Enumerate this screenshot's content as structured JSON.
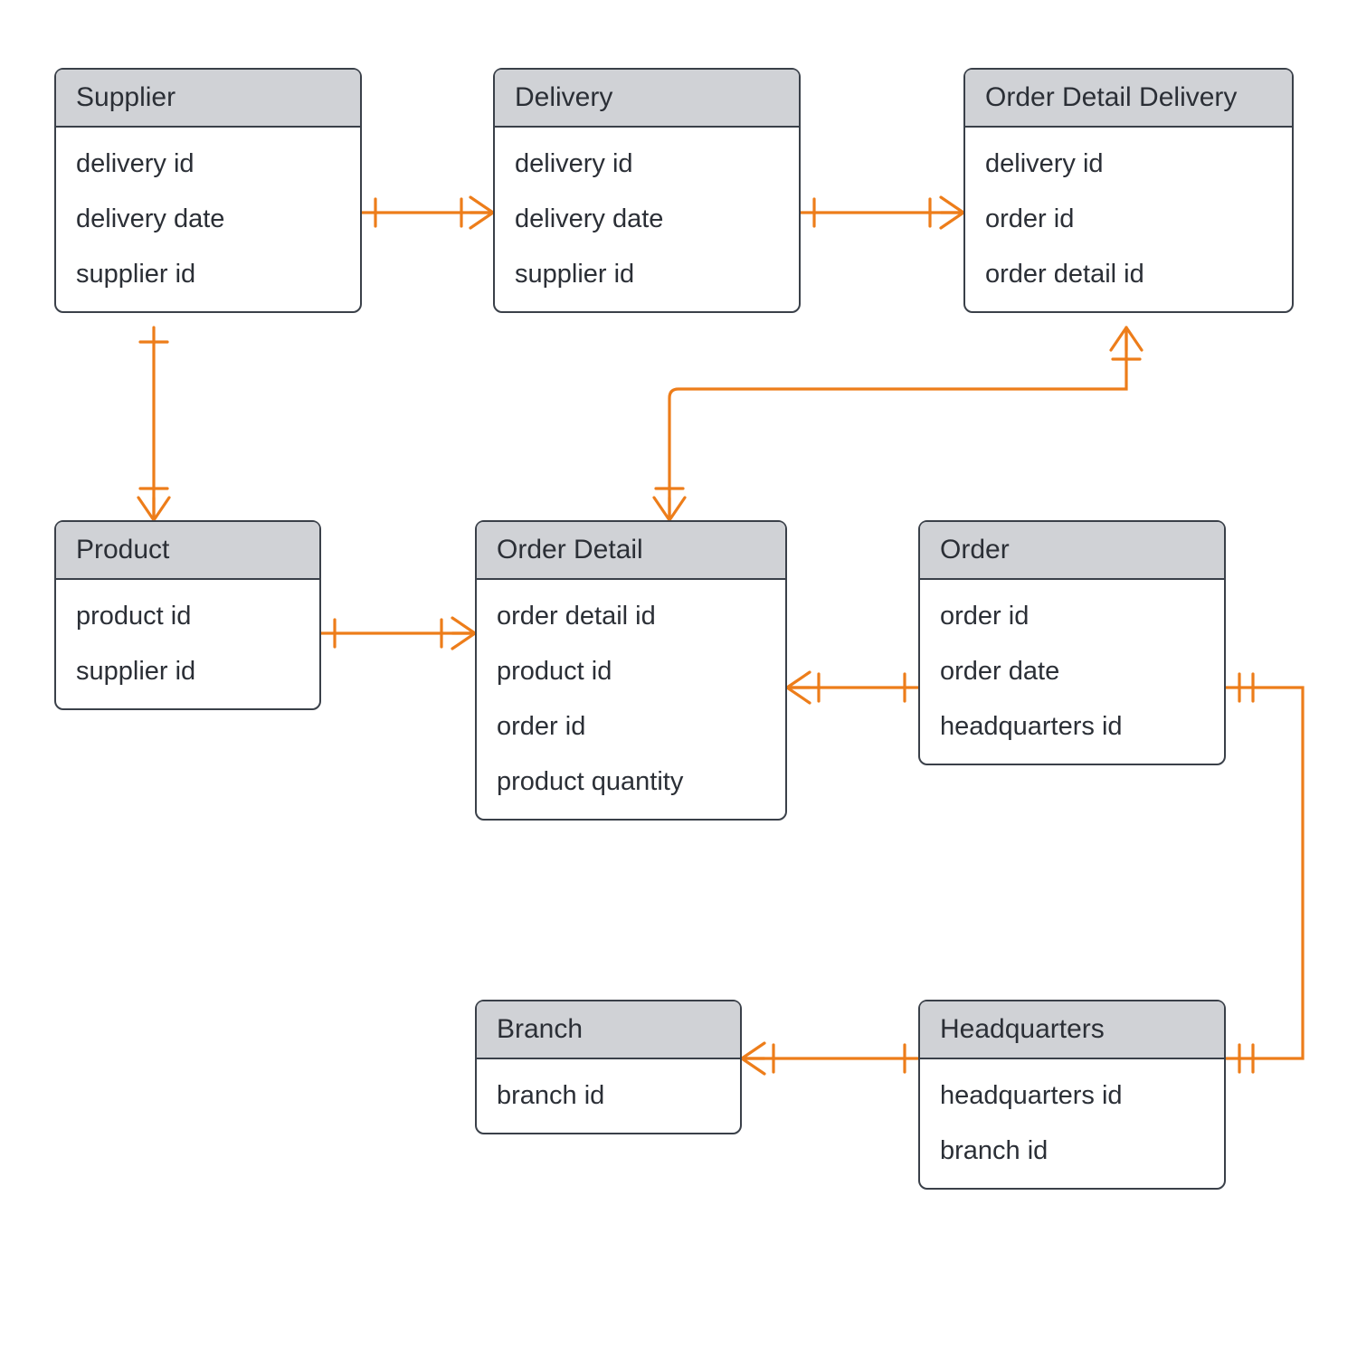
{
  "colors": {
    "line": "#ed7d1a",
    "border": "#3a4049",
    "header_bg": "#d0d2d6"
  },
  "entities": {
    "supplier": {
      "title": "Supplier",
      "attrs": [
        "delivery id",
        "delivery date",
        "supplier id"
      ]
    },
    "delivery": {
      "title": "Delivery",
      "attrs": [
        "delivery id",
        "delivery date",
        "supplier id"
      ]
    },
    "odd": {
      "title": "Order Detail Delivery",
      "attrs": [
        "delivery id",
        "order id",
        "order detail id"
      ]
    },
    "product": {
      "title": "Product",
      "attrs": [
        "product id",
        "supplier id"
      ]
    },
    "od": {
      "title": "Order Detail",
      "attrs": [
        "order detail id",
        "product id",
        "order id",
        "product quantity"
      ]
    },
    "order": {
      "title": "Order",
      "attrs": [
        "order id",
        "order date",
        "headquarters id"
      ]
    },
    "branch": {
      "title": "Branch",
      "attrs": [
        "branch id"
      ]
    },
    "hq": {
      "title": "Headquarters",
      "attrs": [
        "headquarters id",
        "branch id"
      ]
    }
  },
  "relationships": [
    {
      "from": "supplier",
      "to": "delivery",
      "from_end": "one",
      "to_end": "many"
    },
    {
      "from": "delivery",
      "to": "odd",
      "from_end": "one",
      "to_end": "many"
    },
    {
      "from": "supplier",
      "to": "product",
      "from_end": "one",
      "to_end": "many"
    },
    {
      "from": "product",
      "to": "od",
      "from_end": "one",
      "to_end": "many"
    },
    {
      "from": "od",
      "to": "odd",
      "from_end": "many",
      "to_end": "many"
    },
    {
      "from": "od",
      "to": "order",
      "from_end": "many",
      "to_end": "one"
    },
    {
      "from": "order",
      "to": "hq",
      "from_end": "one-one",
      "to_end": "one-one"
    },
    {
      "from": "branch",
      "to": "hq",
      "from_end": "many",
      "to_end": "one"
    }
  ]
}
